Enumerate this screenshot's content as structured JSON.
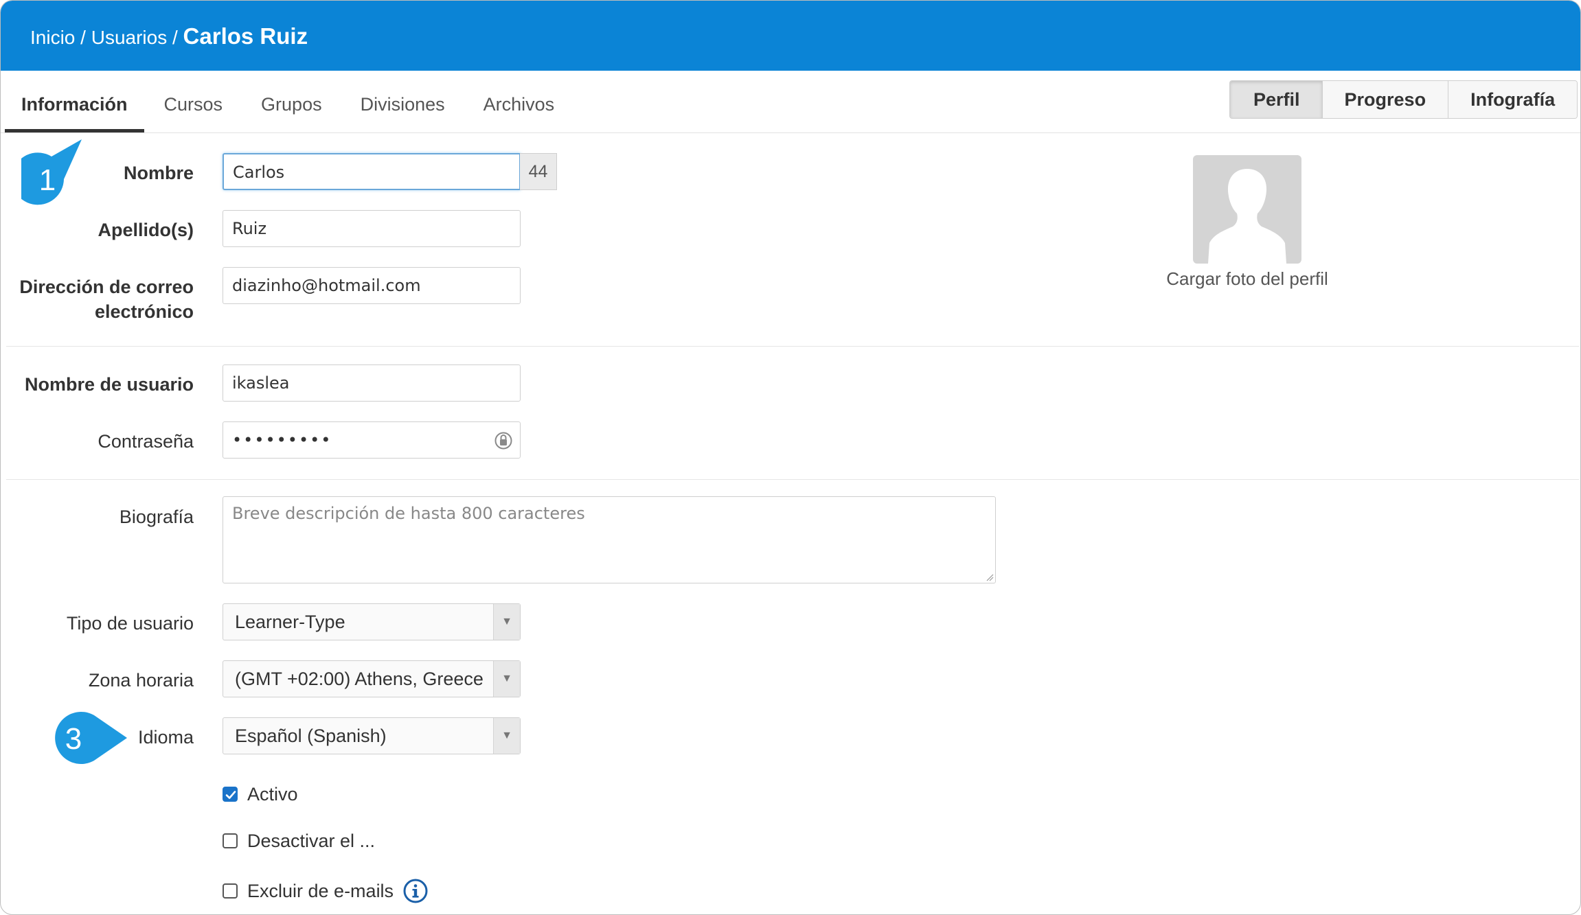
{
  "breadcrumb": {
    "home": "Inicio",
    "sep1": " / ",
    "users": "Usuarios",
    "sep2": " / ",
    "current": "Carlos Ruiz"
  },
  "tabs": [
    {
      "label": "Información",
      "active": true
    },
    {
      "label": "Cursos"
    },
    {
      "label": "Grupos"
    },
    {
      "label": "Divisiones"
    },
    {
      "label": "Archivos"
    }
  ],
  "view_buttons": [
    {
      "label": "Perfil",
      "selected": true
    },
    {
      "label": "Progreso"
    },
    {
      "label": "Infografía"
    }
  ],
  "form": {
    "first_name": {
      "label": "Nombre",
      "value": "Carlos",
      "remaining": "44"
    },
    "last_name": {
      "label": "Apellido(s)",
      "value": "Ruiz"
    },
    "email": {
      "label_line1": "Dirección de correo",
      "label_line2": "electrónico",
      "value": "diazinho@hotmail.com"
    },
    "username": {
      "label": "Nombre de usuario",
      "value": "ikaslea"
    },
    "password": {
      "label": "Contraseña",
      "value": "•••••••••"
    },
    "bio": {
      "label": "Biografía",
      "placeholder": "Breve descripción de hasta 800 caracteres"
    },
    "user_type": {
      "label": "Tipo de usuario",
      "value": "Learner-Type"
    },
    "timezone": {
      "label": "Zona horaria",
      "value": "(GMT +02:00) Athens, Greece"
    },
    "language": {
      "label": "Idioma",
      "value": "Español (Spanish)"
    },
    "active": {
      "label": "Activo",
      "checked": true
    },
    "deactivate": {
      "label": "Desactivar el ...",
      "checked": false
    },
    "exclude_emails": {
      "label": "Excluir de e-mails",
      "checked": false
    }
  },
  "profile": {
    "upload_label": "Cargar foto del perfil"
  },
  "callouts": {
    "one": "1",
    "three": "3"
  },
  "colors": {
    "header": "#0b84d6",
    "callout": "#1e9ae0",
    "checkbox": "#1a73c9"
  }
}
